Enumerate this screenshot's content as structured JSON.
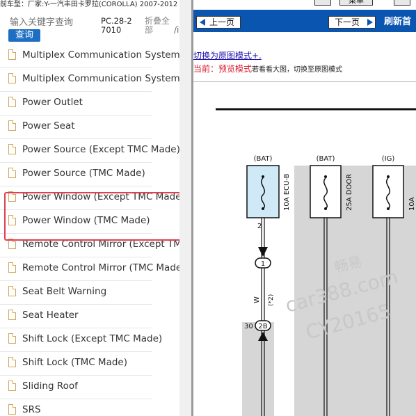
{
  "top": {
    "vehicle_info": "前车型：厂家:Y-一汽丰田卡罗拉(COROLLA) 2007-2012",
    "menu_label": "菜单"
  },
  "search": {
    "placeholder": "输入关键字查询",
    "button": "查询",
    "pc_label": "PC.28-27010",
    "fold_label": "折叠全部",
    "fold_sep": "/i"
  },
  "list": [
    "Multiplex Communication System (C",
    "Multiplex Communication System (C",
    "Power Outlet",
    "Power Seat",
    "Power Source (Except TMC Made)",
    "Power Source (TMC Made)",
    "Power Window (Except TMC Made)",
    "Power Window (TMC Made)",
    "Remote Control Mirror (Except TMC",
    "Remote Control Mirror (TMC Made)",
    "Seat Belt Warning",
    "Seat Heater",
    "Shift Lock (Except TMC Made)",
    "Shift Lock (TMC Made)",
    "Sliding Roof",
    "SRS"
  ],
  "nav": {
    "prev": "上一页",
    "next": "下一页",
    "refresh": "刷新首"
  },
  "view": {
    "switch_link": "切换为原图模式+.",
    "current_prefix": "当前：预览模式",
    "current_suffix": "若看看大图，切换至原图模式"
  },
  "diagram": {
    "fuse1_source": "(BAT)",
    "fuse1_label": "10A ECU-B",
    "fuse1_pin": "2",
    "fuse2_source": "(BAT)",
    "fuse2_label": "25A DOOR",
    "fuse3_source": "(IG)",
    "fuse3_label": "10A",
    "connector1": "1",
    "wire_color": "W",
    "wire_note": "(*2)",
    "connector2_pin": "30",
    "connector2": "2B"
  },
  "watermark": {
    "line1": "畅易",
    "line2": "car388.com",
    "line3": "CY20165"
  },
  "colors": {
    "accent": "#0a55b0",
    "button": "#1e6fc4",
    "highlight": "#e04050",
    "fuse_fill": "#cfe9f6",
    "diagram_gray": "#d6d6d6"
  }
}
